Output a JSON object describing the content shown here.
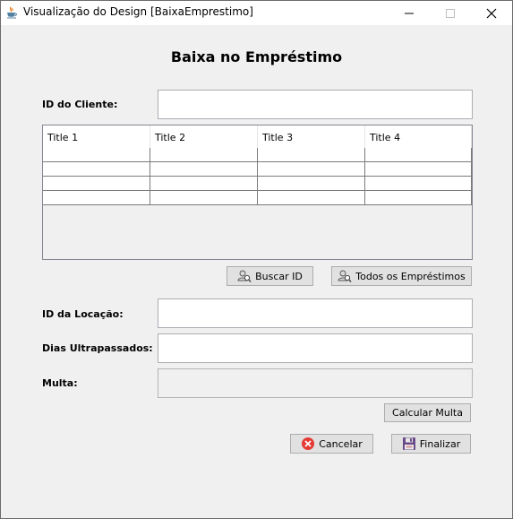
{
  "window": {
    "title": "Visualização do Design [BaixaEmprestimo]"
  },
  "form": {
    "heading": "Baixa no Empréstimo",
    "client_id_label": "ID do Cliente:",
    "client_id_value": "",
    "location_id_label": "ID da Locação:",
    "location_id_value": "",
    "overdue_days_label": "Dias Ultrapassados:",
    "overdue_days_value": "",
    "fine_label": "Multa:",
    "fine_value": ""
  },
  "table": {
    "columns": [
      "Title 1",
      "Title 2",
      "Title 3",
      "Title 4"
    ],
    "rows": [
      [
        "",
        "",
        "",
        ""
      ],
      [
        "",
        "",
        "",
        ""
      ],
      [
        "",
        "",
        "",
        ""
      ],
      [
        "",
        "",
        "",
        ""
      ]
    ]
  },
  "buttons": {
    "search_id": "Buscar ID",
    "all_loans": "Todos os Empréstimos",
    "calculate_fine": "Calcular Multa",
    "cancel": "Cancelar",
    "finish": "Finalizar"
  },
  "icons": {
    "app": "java-cup-icon",
    "search": "user-search-icon",
    "cancel": "cancel-circle-icon",
    "finish": "save-disk-icon"
  },
  "colors": {
    "cancel_red": "#e53935",
    "disk_purple": "#6a4b8a"
  }
}
